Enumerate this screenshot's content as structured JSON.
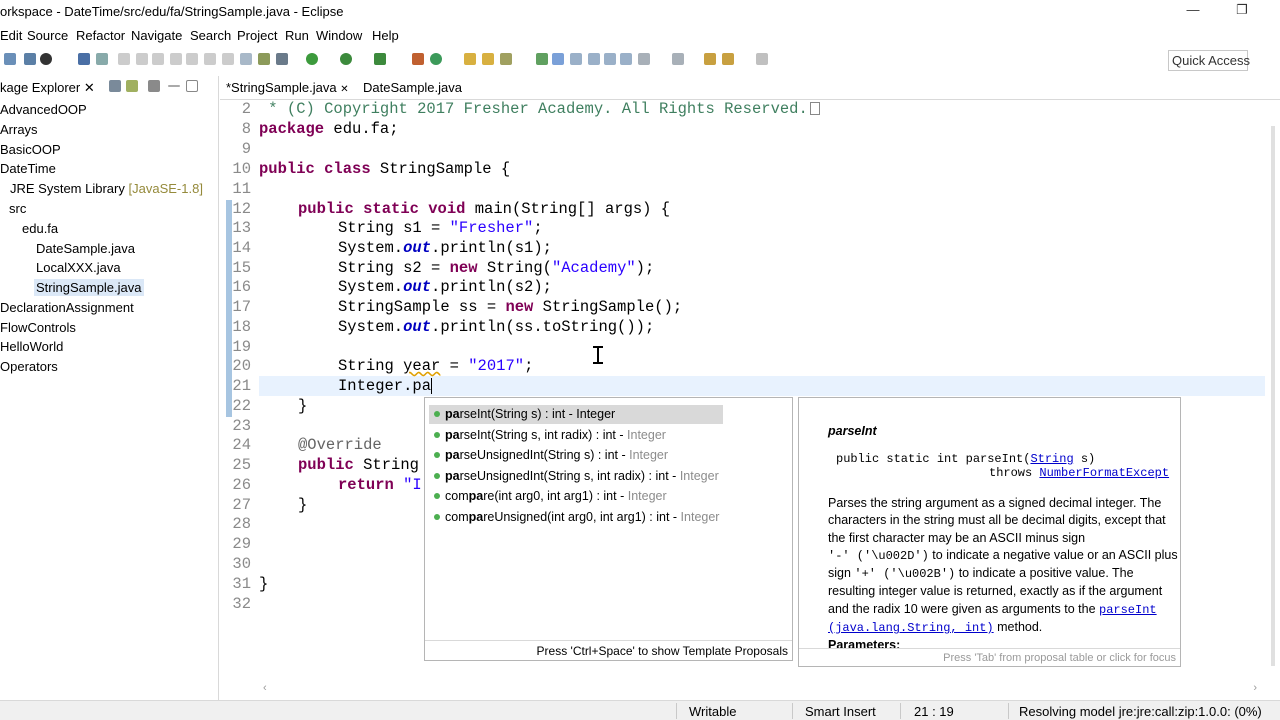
{
  "window": {
    "title": "orkspace - DateTime/src/edu/fa/StringSample.java - Eclipse",
    "minimize": "—",
    "restore": "❐"
  },
  "menu": [
    "Edit",
    "Source",
    "Refactor",
    "Navigate",
    "Search",
    "Project",
    "Run",
    "Window",
    "Help"
  ],
  "toolbar": {
    "quick_access": "Quick Access"
  },
  "explorer": {
    "title": "kage Explorer ✕",
    "items": [
      {
        "label": "AdvancedOOP"
      },
      {
        "label": "Arrays"
      },
      {
        "label": "BasicOOP"
      },
      {
        "label": "DateTime"
      },
      {
        "label": "JRE System Library",
        "decoration": "[JavaSE-1.8]"
      },
      {
        "label": "src"
      },
      {
        "label": "edu.fa"
      },
      {
        "label": "DateSample.java"
      },
      {
        "label": "LocalXXX.java"
      },
      {
        "label": "StringSample.java"
      },
      {
        "label": "DeclarationAssignment"
      },
      {
        "label": "FlowControls"
      },
      {
        "label": "HelloWorld"
      },
      {
        "label": "Operators"
      }
    ]
  },
  "tabs": [
    {
      "label": "*StringSample.java",
      "close": "✕"
    },
    {
      "label": "DateSample.java"
    }
  ],
  "code": {
    "line_numbers": [
      "2",
      "8",
      "9",
      "10",
      "11",
      "12",
      "13",
      "14",
      "15",
      "16",
      "17",
      "18",
      "19",
      "20",
      "21",
      "22",
      "23",
      "24",
      "25",
      "26",
      "27",
      "28",
      "29",
      "30",
      "31",
      "32"
    ],
    "l2": " * (C) Copyright 2017 Fresher Academy. All Rights Reserved.",
    "l8_kw": "package",
    "l8": " edu.fa;",
    "l10_kw": "public class",
    "l10": " StringSample {",
    "l12_kw": "public static void",
    "l12": " main(String[] args) {",
    "l13a": "String s1 = ",
    "l13s": "\"Fresher\"",
    "l13b": ";",
    "l14a": "System.",
    "l14f": "out",
    "l14b": ".println(s1);",
    "l15a": "String s2 = ",
    "l15k": "new",
    "l15b": " String(",
    "l15s": "\"Academy\"",
    "l15c": ");",
    "l16a": "System.",
    "l16f": "out",
    "l16b": ".println(s2);",
    "l17a": "StringSample ss = ",
    "l17k": "new",
    "l17b": " StringSample();",
    "l18a": "System.",
    "l18f": "out",
    "l18b": ".println(ss.toString());",
    "l20a": "String ",
    "l20v": "year",
    "l20b": " = ",
    "l20s": "\"2017\"",
    "l20c": ";",
    "l21": "Integer.pa",
    "l22": "}",
    "l24": "@Override",
    "l25_kw": "public",
    "l25": " String",
    "l26_kw": "return",
    "l26": " \"I",
    "l27": "}",
    "l31": "}"
  },
  "proposals": {
    "items": [
      {
        "bold": "pa",
        "rest": "rseInt(String s) : int - Integer",
        "cls": ""
      },
      {
        "bold": "pa",
        "rest": "rseInt(String s, int radix) : int - ",
        "cls": "Integer"
      },
      {
        "bold": "pa",
        "rest": "rseUnsignedInt(String s) : int - ",
        "cls": "Integer"
      },
      {
        "bold": "pa",
        "rest": "rseUnsignedInt(String s, int radix) : int - ",
        "cls": "Integer"
      },
      {
        "pre": "com",
        "bold": "pa",
        "rest": "re(int arg0, int arg1) : int - ",
        "cls": "Integer"
      },
      {
        "pre": "com",
        "bold": "pa",
        "rest": "reUnsigned(int arg0, int arg1) : int - ",
        "cls": "Integer"
      }
    ],
    "footer": "Press 'Ctrl+Space' to show Template Proposals"
  },
  "doc": {
    "heading": "parseInt",
    "sig1a": "public static int parseInt(",
    "sig1link": "String",
    "sig1b": " s)",
    "sig2a": "throws ",
    "sig2link": "NumberFormatExcept",
    "p1": "Parses the string argument as a signed decimal integer. The",
    "p2": "characters in the string must all be decimal digits, except that",
    "p3": "the first character may be an ASCII minus sign",
    "p4a": "'-' ('\\u002D')",
    "p4b": " to indicate a negative value or an ASCII plus",
    "p5a": "sign ",
    "p5b": "'+' ('\\u002B')",
    "p5c": " to indicate a positive value. The",
    "p6": "resulting integer value is returned, exactly as if the argument",
    "p7a": "and the radix 10 were given as arguments to the ",
    "p7link": "parseInt",
    "p8link": "(java.lang.String, int)",
    "p8b": " method.",
    "params": "Parameters:",
    "footer": "Press 'Tab' from proposal table or click for focus"
  },
  "status": {
    "writable": "Writable",
    "insert": "Smart Insert",
    "position": "21 : 19",
    "message": "Resolving model jre:jre:call:zip:1.0.0: (0%)"
  },
  "colors": {
    "keyword": "#7f0055",
    "string": "#2a00ff",
    "field": "#0000c0",
    "current_line": "#e8f2fe",
    "selection": "#dbe8f7"
  }
}
